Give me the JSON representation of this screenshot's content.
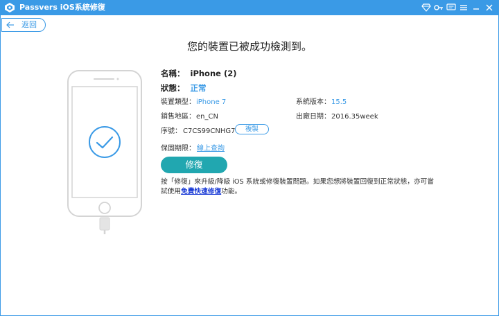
{
  "titlebar": {
    "title": "Passvers iOS系統修復",
    "icons": [
      "diamond-icon",
      "key-icon",
      "feedback-icon",
      "menu-icon",
      "minimize-icon",
      "close-icon"
    ]
  },
  "nav": {
    "back_label": "返回"
  },
  "main": {
    "title": "您的裝置已被成功檢測到。",
    "name_label": "名稱：",
    "name_value": "iPhone (2)",
    "status_label": "狀態：",
    "status_value": "正常",
    "device_type_label": "裝置類型：",
    "device_type_value": "iPhone 7",
    "system_version_label": "系統版本：",
    "system_version_value": "15.5",
    "sales_region_label": "銷售地區：",
    "sales_region_value": "en_CN",
    "release_date_label": "出廠日期：",
    "release_date_value": "2016.35week",
    "serial_label": "序號：",
    "serial_value": "C7CS99CNHG74",
    "copy_label": "複製",
    "warranty_label": "保固期限：",
    "warranty_link": "線上查詢",
    "repair_label": "修復",
    "note_prefix": "按「修復」來升級/降級 iOS 系統或修復裝置問題。如果您想將裝置回復到正常狀態，亦可嘗試使用",
    "note_link": "免費快速修復",
    "note_suffix": "功能。"
  },
  "colors": {
    "accent": "#3a9ae6",
    "repair_button": "#21a7b0",
    "link": "#1a3bd6",
    "phone_outline": "#d4d4d4"
  }
}
